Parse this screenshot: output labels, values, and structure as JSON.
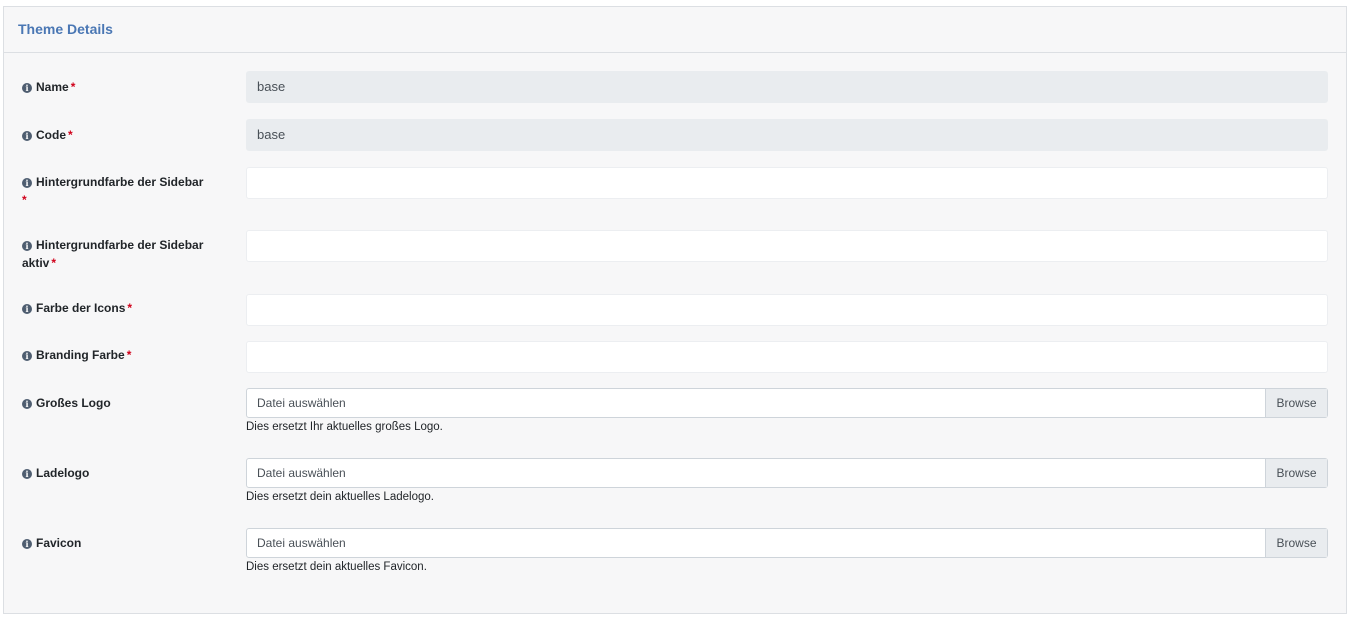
{
  "card": {
    "title": "Theme Details"
  },
  "fields": {
    "name": {
      "label": "Name",
      "required": "*",
      "value": "base"
    },
    "code": {
      "label": "Code",
      "required": "*",
      "value": "base"
    },
    "sidebar_bg": {
      "label": "Hintergrundfarbe der Sidebar",
      "required": "*",
      "value": ""
    },
    "sidebar_bg_active": {
      "label_line1": "Hintergrundfarbe der Sidebar",
      "label_line2": "aktiv",
      "required": "*",
      "value": ""
    },
    "icon_color": {
      "label": "Farbe der Icons",
      "required": "*",
      "value": ""
    },
    "branding_color": {
      "label": "Branding Farbe",
      "required": "*",
      "value": ""
    },
    "large_logo": {
      "label": "Großes Logo",
      "placeholder": "Datei auswählen",
      "button": "Browse",
      "help": "Dies ersetzt Ihr aktuelles großes Logo."
    },
    "loading_logo": {
      "label": "Ladelogo",
      "placeholder": "Datei auswählen",
      "button": "Browse",
      "help": "Dies ersetzt dein aktuelles Ladelogo."
    },
    "favicon": {
      "label": "Favicon",
      "placeholder": "Datei auswählen",
      "button": "Browse",
      "help": "Dies ersetzt dein aktuelles Favicon."
    }
  },
  "icons": {
    "field_info": "info-circle-icon"
  },
  "colors": {
    "header_title": "#4a77b4",
    "required": "#d0021b",
    "readonly_bg": "#e9ecef"
  }
}
